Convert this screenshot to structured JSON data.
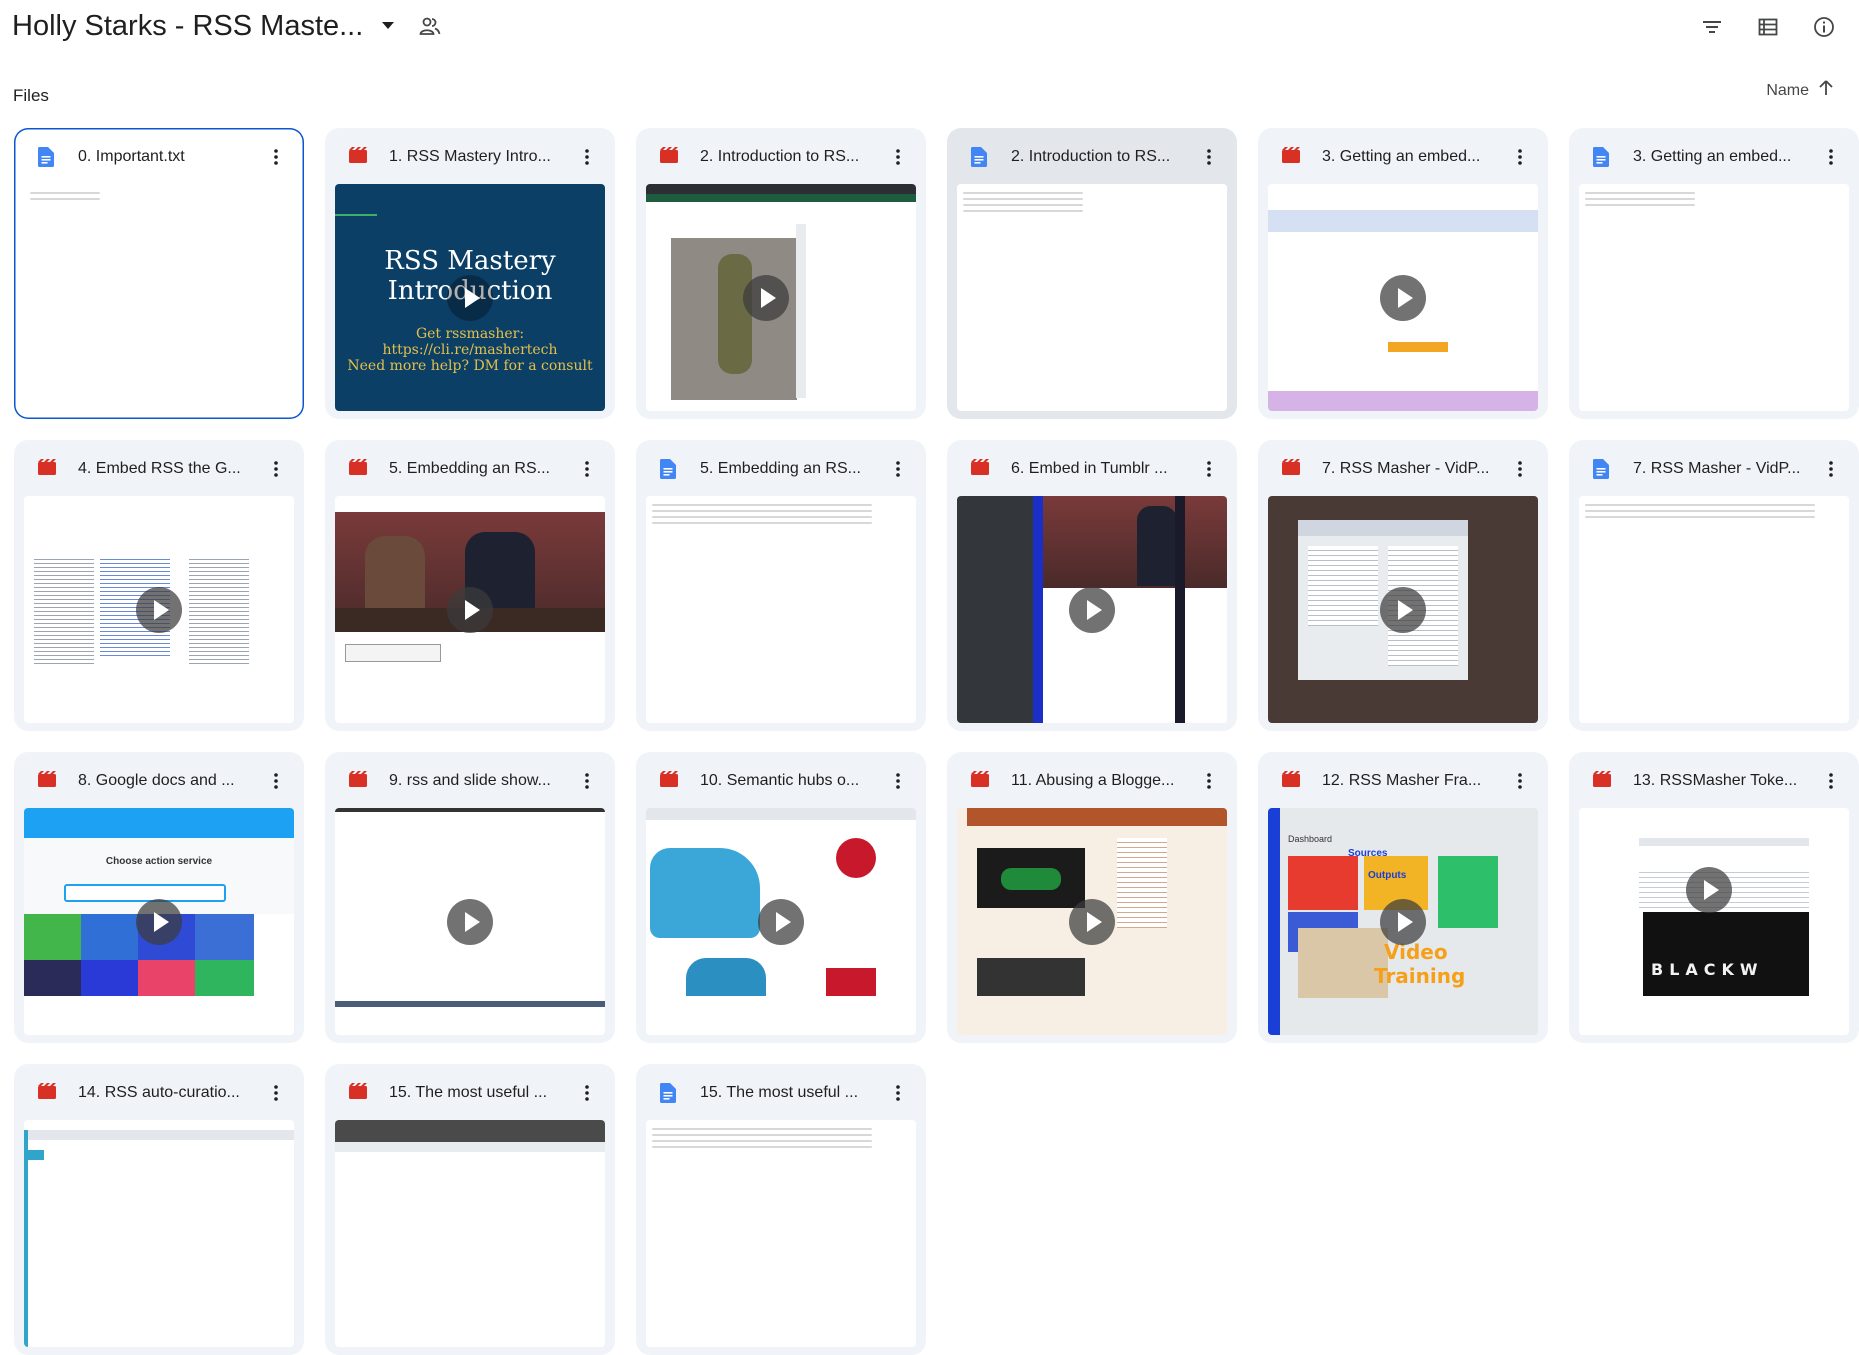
{
  "header": {
    "title": "Holly Starks - RSS Maste...",
    "icons": [
      "chevron-down-icon",
      "shared-people-icon",
      "filter-icon",
      "list-view-icon",
      "info-icon"
    ]
  },
  "section": {
    "label": "Files"
  },
  "sort": {
    "label": "Name",
    "icon": "arrow-up-icon"
  },
  "files": [
    {
      "name": "0. Important.txt",
      "type": "doc"
    },
    {
      "name": "1. RSS Mastery Intro...",
      "type": "video"
    },
    {
      "name": "2. Introduction to RS...",
      "type": "video"
    },
    {
      "name": "2. Introduction to RS...",
      "type": "doc"
    },
    {
      "name": "3. Getting an embed...",
      "type": "video"
    },
    {
      "name": "3. Getting an embed...",
      "type": "doc"
    },
    {
      "name": "4. Embed RSS the G...",
      "type": "video"
    },
    {
      "name": "5. Embedding an RS...",
      "type": "video"
    },
    {
      "name": "5. Embedding an RS...",
      "type": "doc"
    },
    {
      "name": "6. Embed in Tumblr ...",
      "type": "video"
    },
    {
      "name": "7. RSS Masher - VidP...",
      "type": "video"
    },
    {
      "name": "7. RSS Masher - VidP...",
      "type": "doc"
    },
    {
      "name": "8. Google docs and ...",
      "type": "video"
    },
    {
      "name": "9. rss and slide show...",
      "type": "video"
    },
    {
      "name": "10. Semantic hubs o...",
      "type": "video"
    },
    {
      "name": "11. Abusing a Blogge...",
      "type": "video"
    },
    {
      "name": "12. RSS Masher Fra...",
      "type": "video"
    },
    {
      "name": "13. RSSMasher Toke...",
      "type": "video"
    },
    {
      "name": "14. RSS auto-curatio...",
      "type": "video"
    },
    {
      "name": "15. The most useful ...",
      "type": "video"
    },
    {
      "name": "15. The most useful ...",
      "type": "doc"
    }
  ],
  "thumb_text": {
    "intro_line1": "RSS Mastery",
    "intro_line2": "Introduction",
    "intro_get": "Get rssmasher:",
    "intro_url": "https://cli.re/mashertech",
    "intro_help": "Need more help? DM for a consult",
    "choose_action": "Choose action service",
    "dashboard": "Dashboard",
    "sources": "Sources",
    "outputs": "Outputs",
    "video_word": "Video",
    "training_word": "Training",
    "blackw": "BLACKW"
  },
  "colors": {
    "card_bg": "#f0f4f9",
    "selected_border": "#0b57d0",
    "doc_icon": "#4285f4",
    "video_icon": "#d93025",
    "text": "#1f1f1f"
  }
}
